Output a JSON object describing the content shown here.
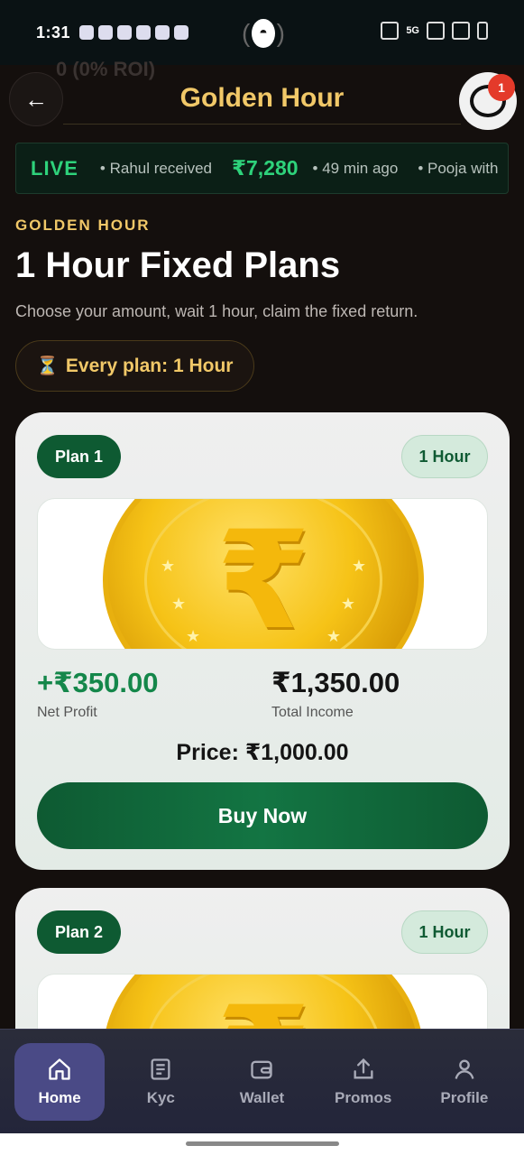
{
  "status_bar": {
    "time": "1:31",
    "network": "5G"
  },
  "header": {
    "ghost_roi": "0 (0% ROI)",
    "title": "Golden Hour",
    "chat_badge": "1"
  },
  "ticker": {
    "live_label": "LIVE",
    "item1_text": "• Rahul received",
    "item1_amount": "₹7,280",
    "item2_text": "• 49 min ago",
    "item3_text": "• Pooja with"
  },
  "intro": {
    "eyebrow": "GOLDEN HOUR",
    "title": "1 Hour Fixed Plans",
    "subtitle": "Choose your amount, wait 1 hour, claim the fixed return.",
    "pill_icon": "⏳",
    "pill_text": "Every plan: 1 Hour"
  },
  "plans": [
    {
      "name": "Plan 1",
      "duration": "1 Hour",
      "net_profit": "+₹350.00",
      "net_profit_label": "Net Profit",
      "total_income": "₹1,350.00",
      "total_income_label": "Total Income",
      "price": "Price: ₹1,000.00",
      "buy_label": "Buy Now"
    },
    {
      "name": "Plan 2",
      "duration": "1 Hour"
    }
  ],
  "nav": {
    "items": [
      {
        "label": "Home",
        "icon": "home-icon",
        "active": true
      },
      {
        "label": "Kyc",
        "icon": "document-icon",
        "active": false
      },
      {
        "label": "Wallet",
        "icon": "wallet-icon",
        "active": false
      },
      {
        "label": "Promos",
        "icon": "share-icon",
        "active": false
      },
      {
        "label": "Profile",
        "icon": "user-icon",
        "active": false
      }
    ]
  },
  "colors": {
    "gold": "#f1c868",
    "green": "#0e5a32",
    "live_green": "#2ed27b",
    "nav_active": "#4a4a86"
  }
}
